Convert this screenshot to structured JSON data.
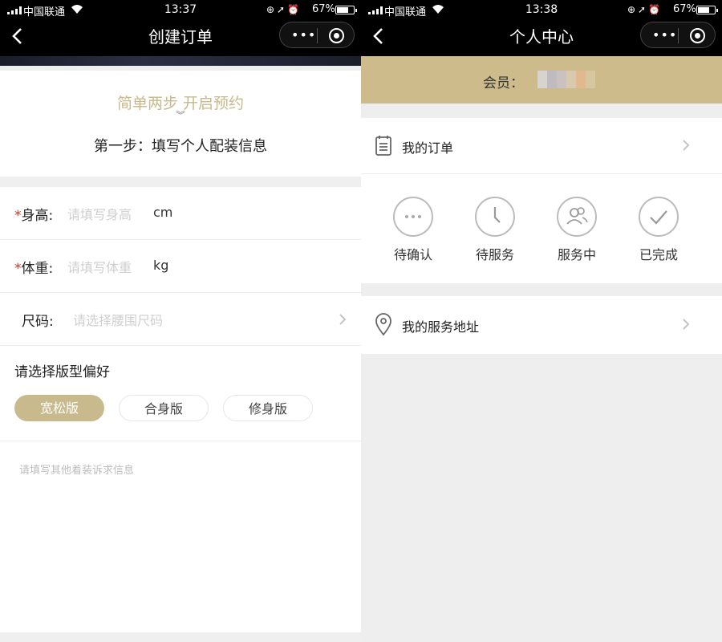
{
  "left": {
    "status": {
      "carrier": "中国联通",
      "time": "13:37",
      "battery": "67%"
    },
    "nav": {
      "title": "创建订单"
    },
    "intro": {
      "slogan": "简单两步 开启预约",
      "step": "第一步：填写个人配装信息"
    },
    "form": {
      "height": {
        "label": "身高:",
        "placeholder": "请填写身高",
        "unit": "cm"
      },
      "weight": {
        "label": "体重:",
        "placeholder": "请填写体重",
        "unit": "kg"
      },
      "size": {
        "label": "尺码:",
        "placeholder": "请选择腰围尺码"
      },
      "fit_title": "请选择版型偏好",
      "fit_options": [
        "宽松版",
        "合身版",
        "修身版"
      ],
      "fit_selected": "宽松版",
      "remarks_placeholder": "请填写其他着装诉求信息"
    }
  },
  "right": {
    "status": {
      "carrier": "中国联通",
      "time": "13:38",
      "battery": "67%"
    },
    "nav": {
      "title": "个人中心"
    },
    "member": {
      "label": "会员："
    },
    "orders": {
      "title": "我的订单",
      "statuses": [
        "待确认",
        "待服务",
        "服务中",
        "已完成"
      ]
    },
    "address": {
      "title": "我的服务地址"
    }
  },
  "colors": {
    "gold": "#c9ba8d",
    "required": "#c0392b",
    "nav_bg": "#000000"
  }
}
